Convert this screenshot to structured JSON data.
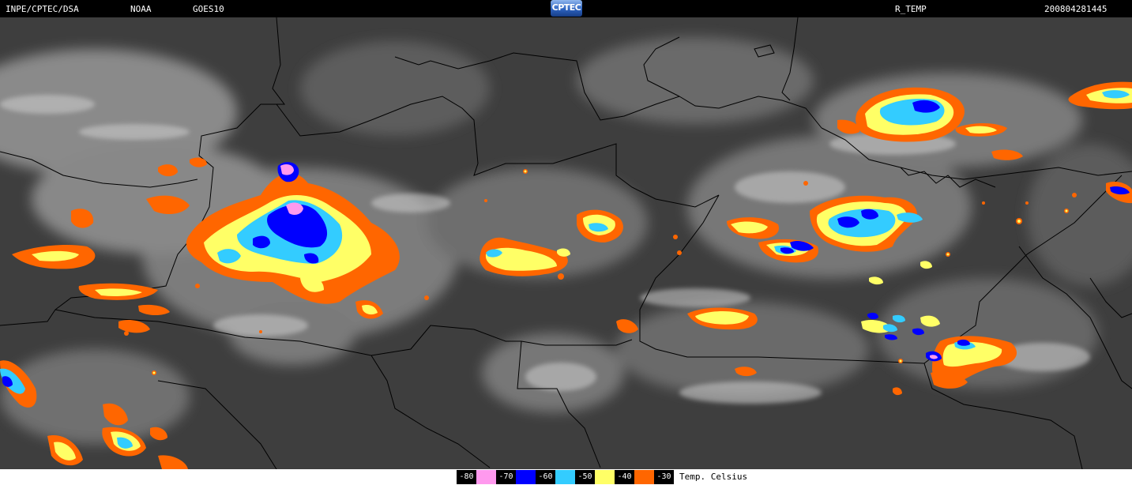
{
  "header": {
    "agency": "INPE/CPTEC/DSA",
    "source": "NOAA",
    "satellite": "GOES10",
    "logo_text": "CPTEC",
    "product": "R_TEMP",
    "timestamp": "200804281445"
  },
  "legend": {
    "unit_label": "Temp. Celsius",
    "items": [
      {
        "label": "-80",
        "color": "#ff99ee"
      },
      {
        "label": "-70",
        "color": "#0000ff"
      },
      {
        "label": "-60",
        "color": "#33ccff"
      },
      {
        "label": "-50",
        "color": "#ffff66"
      },
      {
        "label": "-40",
        "color": "#ff6600"
      },
      {
        "label": "-30",
        "color": "#000000"
      }
    ]
  }
}
